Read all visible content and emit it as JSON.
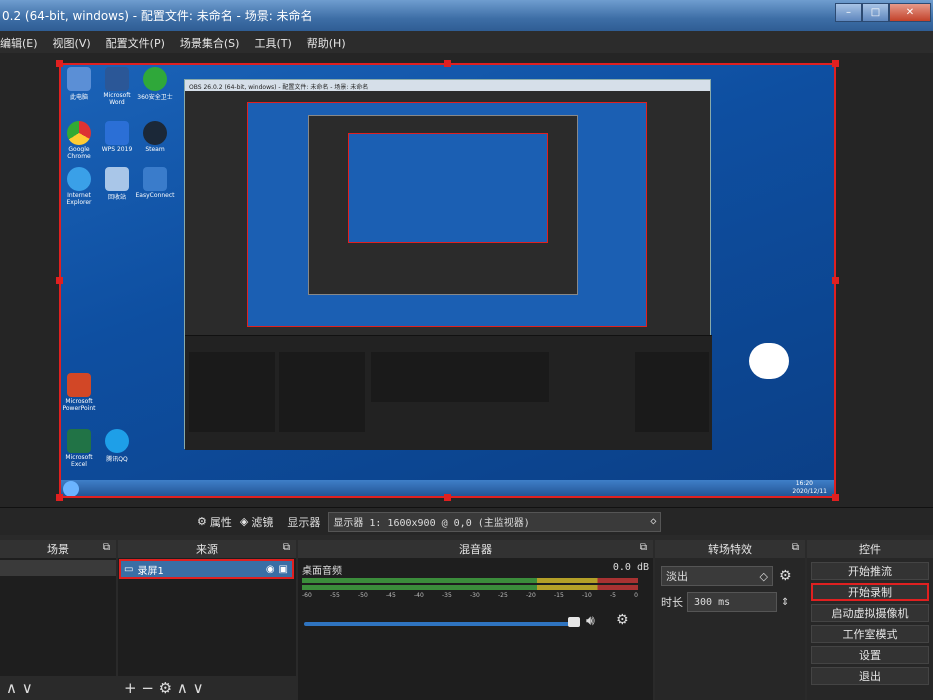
{
  "window": {
    "title": "0.2 (64-bit, windows) - 配置文件: 未命名 - 场景: 未命名",
    "min": "–",
    "max": "□",
    "close": "✕"
  },
  "menu": [
    "编辑(E)",
    "视图(V)",
    "配置文件(P)",
    "场景集合(S)",
    "工具(T)",
    "帮助(H)"
  ],
  "toolbar": {
    "properties": "属性",
    "filters": "滤镜",
    "display_label": "显示器",
    "display_value": "显示器 1: 1600x900 @ 0,0 (主监视器)",
    "arrow": "◇"
  },
  "desktop": {
    "icons": [
      "此电脑",
      "Microsoft Word",
      "360安全卫士",
      "Google Chrome",
      "WPS 2019",
      "Steam",
      "Internet Explorer",
      "回收站",
      "EasyConnect",
      "Microsoft PowerPoint",
      "Microsoft Excel",
      "腾讯QQ"
    ],
    "time": "16:20",
    "date": "2020/12/11",
    "inner_title": "OBS 26.0.2 (64-bit, windows) - 配置文件: 未命名 - 场景: 未命名"
  },
  "docks": {
    "scenes": {
      "title": "场景",
      "controls": "∧ ∨"
    },
    "sources": {
      "title": "来源",
      "item": "录屏1",
      "controls": "+ − ⚙ ∧ ∨"
    },
    "mixer": {
      "title": "混音器",
      "track": "桌面音频",
      "level": "0.0 dB",
      "ticks": [
        "-60",
        "-55",
        "-50",
        "-45",
        "-40",
        "-35",
        "-30",
        "-25",
        "-20",
        "-15",
        "-10",
        "-5",
        "0"
      ]
    },
    "transitions": {
      "title": "转场特效",
      "selected": "淡出",
      "duration_label": "时长",
      "duration_value": "300 ms"
    },
    "controls": {
      "title": "控件",
      "buttons": [
        "开始推流",
        "开始录制",
        "启动虚拟摄像机",
        "工作室模式",
        "设置",
        "退出"
      ]
    }
  },
  "colors": {
    "accent": "#3a6ea5",
    "highlight": "#e02020"
  }
}
